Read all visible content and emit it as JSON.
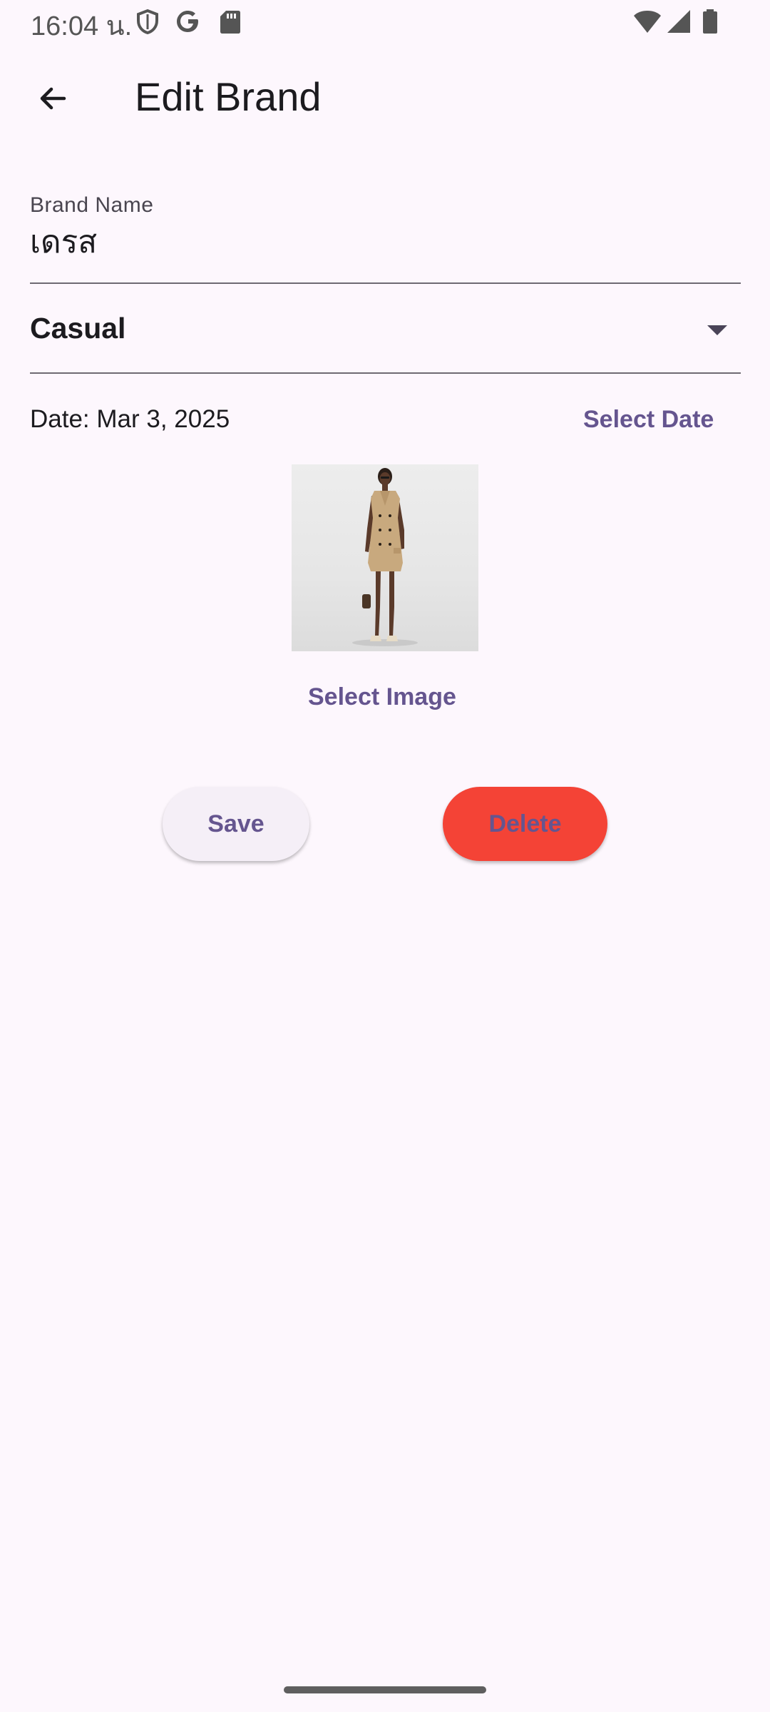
{
  "status_bar": {
    "time": "16:04 น.",
    "icons": [
      "shield-icon",
      "google-icon",
      "sd-card-icon",
      "wifi-icon",
      "signal-icon",
      "battery-icon"
    ]
  },
  "app_bar": {
    "back_icon": "arrow-back-icon",
    "title": "Edit Brand"
  },
  "form": {
    "brand_name_label": "Brand Name",
    "brand_name_value": "เดรส",
    "category_value": "Casual",
    "date_text": "Date: Mar 3, 2025",
    "select_date_label": "Select Date",
    "select_image_label": "Select Image"
  },
  "actions": {
    "save_label": "Save",
    "delete_label": "Delete"
  },
  "colors": {
    "background": "#FDF7FD",
    "accent": "#65558F",
    "delete": "#F44336"
  }
}
